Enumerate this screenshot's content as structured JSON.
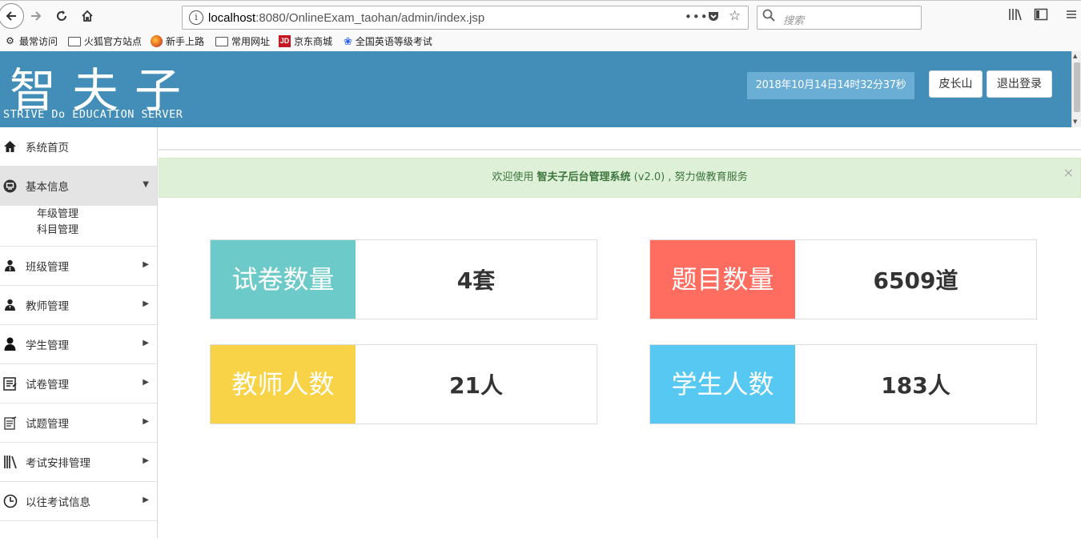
{
  "browser": {
    "url_host": "localhost",
    "url_rest": ":8080/OnlineExam_taohan/admin/index.jsp",
    "search_placeholder": "搜索",
    "bookmarks": [
      "最常访问",
      "火狐官方站点",
      "新手上路",
      "常用网址",
      "京东商城",
      "全国英语等级考试"
    ]
  },
  "header": {
    "logo_cn": "智夫子",
    "logo_en": "STRIVE Do EDUCATION SERVER",
    "datetime": "2018年10月14日14时32分37秒",
    "user_button": "皮长山",
    "logout_button": "退出登录",
    "color": "#438eb9"
  },
  "sidebar": {
    "items": [
      {
        "label": "系统首页",
        "icon": "home-icon"
      },
      {
        "label": "基本信息",
        "icon": "desktop-icon",
        "expanded": true,
        "children": [
          "年级管理",
          "科目管理"
        ]
      },
      {
        "label": "班级管理",
        "icon": "users-icon"
      },
      {
        "label": "教师管理",
        "icon": "teacher-icon"
      },
      {
        "label": "学生管理",
        "icon": "user-icon"
      },
      {
        "label": "试卷管理",
        "icon": "paper-icon"
      },
      {
        "label": "试题管理",
        "icon": "question-icon"
      },
      {
        "label": "考试安排管理",
        "icon": "books-icon"
      },
      {
        "label": "以往考试信息",
        "icon": "clock-icon"
      }
    ]
  },
  "alert": {
    "prefix": "欢迎使用 ",
    "app_name": "智夫子后台管理系统",
    "version": " (v2.0)",
    "suffix": " , 努力做教育服务",
    "close": "×"
  },
  "stats": [
    {
      "label": "试卷数量",
      "value": "4套",
      "color": "#6ccac9"
    },
    {
      "label": "题目数量",
      "value": "6509道",
      "color": "#ff6c60"
    },
    {
      "label": "教师人数",
      "value": "21人",
      "color": "#f8d347"
    },
    {
      "label": "学生人数",
      "value": "183人",
      "color": "#57c8f2"
    }
  ]
}
